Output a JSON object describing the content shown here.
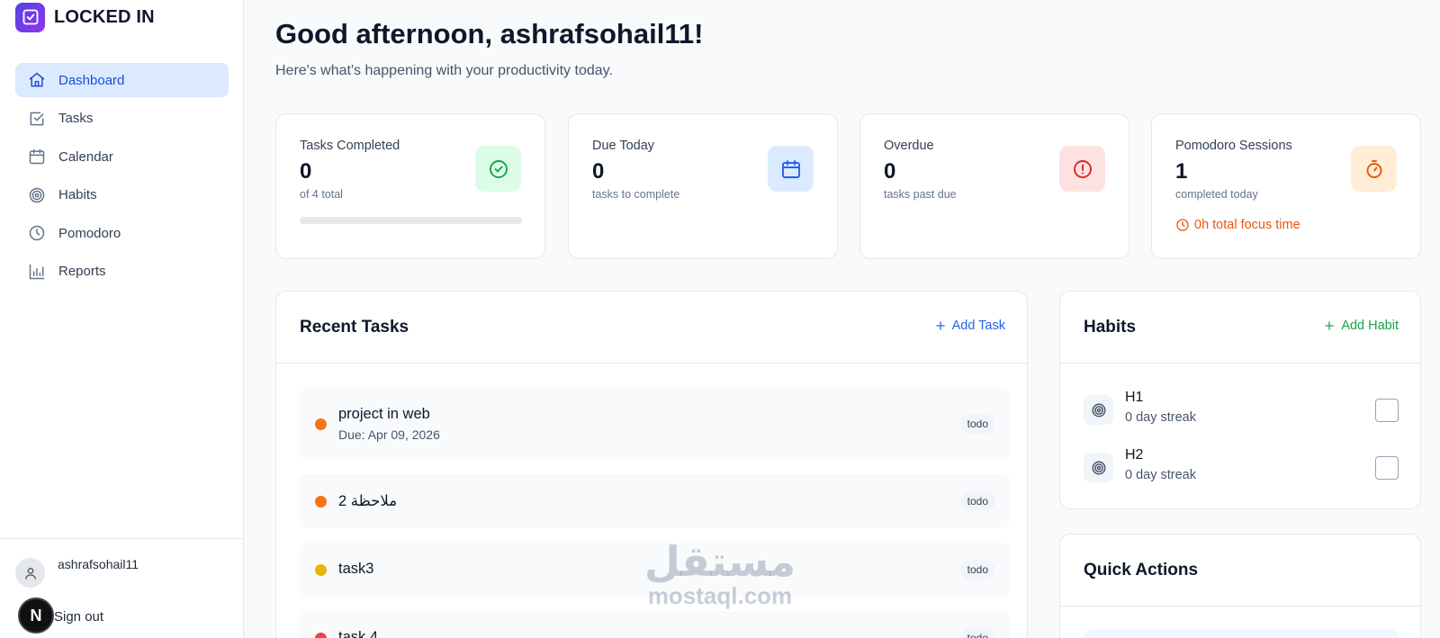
{
  "brand": {
    "name": "LOCKED IN"
  },
  "sidebar": {
    "items": [
      {
        "label": "Dashboard",
        "icon": "home-icon",
        "active": true
      },
      {
        "label": "Tasks",
        "icon": "checkbox-icon",
        "active": false
      },
      {
        "label": "Calendar",
        "icon": "calendar-icon",
        "active": false
      },
      {
        "label": "Habits",
        "icon": "target-icon",
        "active": false
      },
      {
        "label": "Pomodoro",
        "icon": "clock-icon",
        "active": false
      },
      {
        "label": "Reports",
        "icon": "bar-chart-icon",
        "active": false
      }
    ],
    "user": {
      "name": "ashrafsohail11",
      "signout": "Sign out",
      "badge": "N"
    }
  },
  "header": {
    "greeting": "Good afternoon, ashrafsohail11!",
    "subtitle": "Here's what's happening with your productivity today."
  },
  "stats": [
    {
      "label": "Tasks Completed",
      "value": "0",
      "sub": "of 4 total",
      "progress": 0,
      "icon": "check-circle-icon",
      "color": "#16a34a",
      "bg": "#dcfce7"
    },
    {
      "label": "Due Today",
      "value": "0",
      "sub": "tasks to complete",
      "icon": "calendar-icon",
      "color": "#2563eb",
      "bg": "#dbeafe"
    },
    {
      "label": "Overdue",
      "value": "0",
      "sub": "tasks past due",
      "icon": "alert-circle-icon",
      "color": "#dc2626",
      "bg": "#fee2e2"
    },
    {
      "label": "Pomodoro Sessions",
      "value": "1",
      "sub": "completed today",
      "focus": "0h total focus time",
      "icon": "timer-icon",
      "color": "#ea580c",
      "bg": "#ffedd5"
    }
  ],
  "recent_tasks": {
    "title": "Recent Tasks",
    "add_label": "Add Task",
    "items": [
      {
        "title": "project in web",
        "due": "Due: Apr 09, 2026",
        "status": "todo",
        "dot": "#f97316"
      },
      {
        "title": "ملاحظة 2",
        "due": "",
        "status": "todo",
        "dot": "#f97316"
      },
      {
        "title": "task3",
        "due": "",
        "status": "todo",
        "dot": "#eab308"
      },
      {
        "title": "task 4",
        "due": "",
        "status": "todo",
        "dot": "#ef4444"
      }
    ]
  },
  "habits": {
    "title": "Habits",
    "add_label": "Add Habit",
    "items": [
      {
        "name": "H1",
        "streak": "0 day streak"
      },
      {
        "name": "H2",
        "streak": "0 day streak"
      }
    ]
  },
  "quick_actions": {
    "title": "Quick Actions"
  },
  "watermark": {
    "arabic": "مستقل",
    "latin": "mostaql.com"
  },
  "colors": {
    "accent": "#2563eb",
    "habit_accent": "#16a34a"
  }
}
